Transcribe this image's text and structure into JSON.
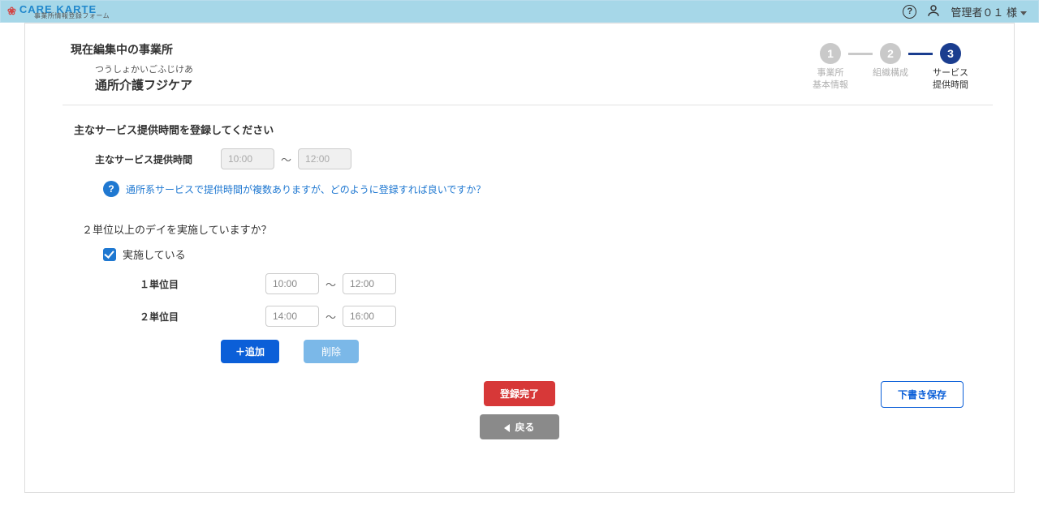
{
  "brand": {
    "name": "CARE KARTE",
    "sub": "事業所情報登録フォーム"
  },
  "user": {
    "name": "管理者０１ 様"
  },
  "page": {
    "editing_heading": "現在編集中の事業所",
    "facility_ruby": "つうしょかいごふじけあ",
    "facility_name": "通所介護フジケア"
  },
  "steps": {
    "step1": {
      "num": "1",
      "label1": "事業所",
      "label2": "基本情報"
    },
    "step2": {
      "num": "2",
      "label1": "組織構成"
    },
    "step3": {
      "num": "3",
      "label1": "サービス",
      "label2": "提供時間"
    }
  },
  "section1": {
    "heading": "主なサービス提供時間を登録してください",
    "main_label": "主なサービス提供時間",
    "time_from": "10:00",
    "time_to": "12:00",
    "help_text": "通所系サービスで提供時間が複数ありますが、どのように登録すれば良いですか？"
  },
  "section2": {
    "question": "２単位以上のデイを実施していますか？",
    "checkbox_label": "実施している",
    "unit1_label": "１単位目",
    "unit1_from": "10:00",
    "unit1_to": "12:00",
    "unit2_label": "２単位目",
    "unit2_from": "14:00",
    "unit2_to": "16:00",
    "add_btn": "＋追加",
    "del_btn": "削除"
  },
  "footer": {
    "register": "登録完了",
    "back": "戻る",
    "draft": "下書き保存"
  }
}
